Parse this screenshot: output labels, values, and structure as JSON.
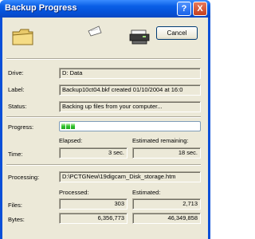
{
  "window": {
    "title": "Backup Progress",
    "help_label": "?",
    "close_label": "X",
    "cancel_label": "Cancel"
  },
  "icons": [
    "folder-icon",
    "flying-paper-icon",
    "printer-icon"
  ],
  "fields": {
    "drive_label": "Drive:",
    "drive_value": "D: Data",
    "label_label": "Label:",
    "label_value": "Backup10ct04.bkf created 01/10/2004 at 16:0",
    "status_label": "Status:",
    "status_value": "Backing up files from your computer..."
  },
  "progress": {
    "label": "Progress:",
    "fraction": 0.1
  },
  "time": {
    "label": "Time:",
    "elapsed_header": "Elapsed:",
    "elapsed_value": "3 sec.",
    "remaining_header": "Estimated remaining:",
    "remaining_value": "18 sec."
  },
  "processing": {
    "label": "Processing:",
    "value": "D:\\PCTGNew\\19digcam_Disk_storage.htm"
  },
  "counts": {
    "processed_header": "Processed:",
    "estimated_header": "Estimated:",
    "files_label": "Files:",
    "files_processed": "303",
    "files_estimated": "2,713",
    "bytes_label": "Bytes:",
    "bytes_processed": "6,356,773",
    "bytes_estimated": "46,349,858"
  },
  "colors": {
    "titlebar": "#0a5fe6",
    "dialog_bg": "#ece9d8",
    "progress_green": "#30c22d"
  }
}
